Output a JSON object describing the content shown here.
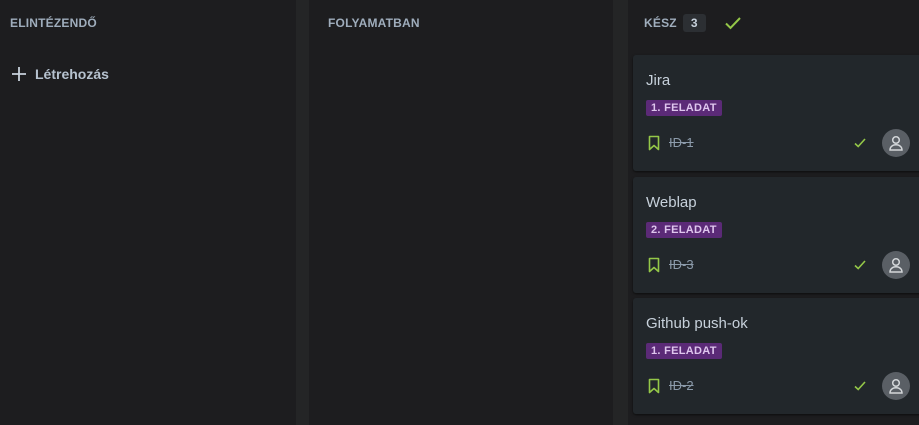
{
  "board": {
    "columns": [
      {
        "title": "ELINTÉZENDŐ"
      },
      {
        "title": "FOLYAMATBAN"
      },
      {
        "title": "KÉSZ",
        "count": "3"
      }
    ],
    "create_label": "Létrehozás",
    "cards": [
      {
        "title": "Jira",
        "epic": "1. FELADAT",
        "id": "ID-1"
      },
      {
        "title": "Weblap",
        "epic": "2. FELADAT",
        "id": "ID-3"
      },
      {
        "title": "Github push-ok",
        "epic": "1. FELADAT",
        "id": "ID-2"
      }
    ]
  },
  "colors": {
    "background": "#1d1d1f",
    "card": "#22272b",
    "epic_badge": "#5b2a77",
    "done_green": "#94c748"
  },
  "icons": {
    "plus": "plus-icon",
    "done": "check-icon",
    "issue_type": "bookmark-icon",
    "assignee": "avatar-icon"
  }
}
